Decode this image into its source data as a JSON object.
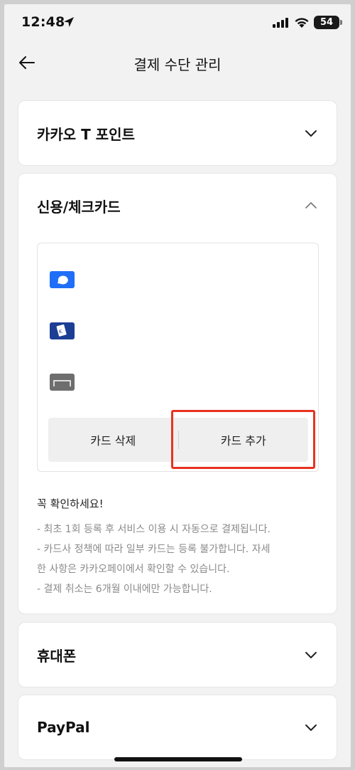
{
  "status_bar": {
    "time": "12:48",
    "battery": "54"
  },
  "header": {
    "title": "결제 수단 관리"
  },
  "sections": {
    "kakao_point": {
      "title": "카카오 T 포인트"
    },
    "credit_card": {
      "title": "신용/체크카드",
      "cards": [
        {
          "icon": "blue-speech-card-icon",
          "color": "#1f6ef7"
        },
        {
          "icon": "navy-card-icon",
          "color": "#1c3f94"
        },
        {
          "icon": "gray-card-icon",
          "color": "#6e6e6e"
        }
      ],
      "delete_label": "카드 삭제",
      "add_label": "카드 추가",
      "notice_title": "꼭 확인하세요!",
      "notices": [
        "- 최초 1회 등록 후 서비스 이용 시 자동으로 결제됩니다.",
        "- 카드사 정책에 따라 일부 카드는 등록 불가합니다. 자세",
        "한 사항은 카카오페이에서 확인할 수 있습니다.",
        "- 결제 취소는 6개월 이내에만 가능합니다."
      ]
    },
    "phone": {
      "title": "휴대폰"
    },
    "paypal": {
      "title": "PayPal"
    }
  },
  "colors": {
    "highlight": "#e8331f",
    "background": "#f2f2f2"
  }
}
